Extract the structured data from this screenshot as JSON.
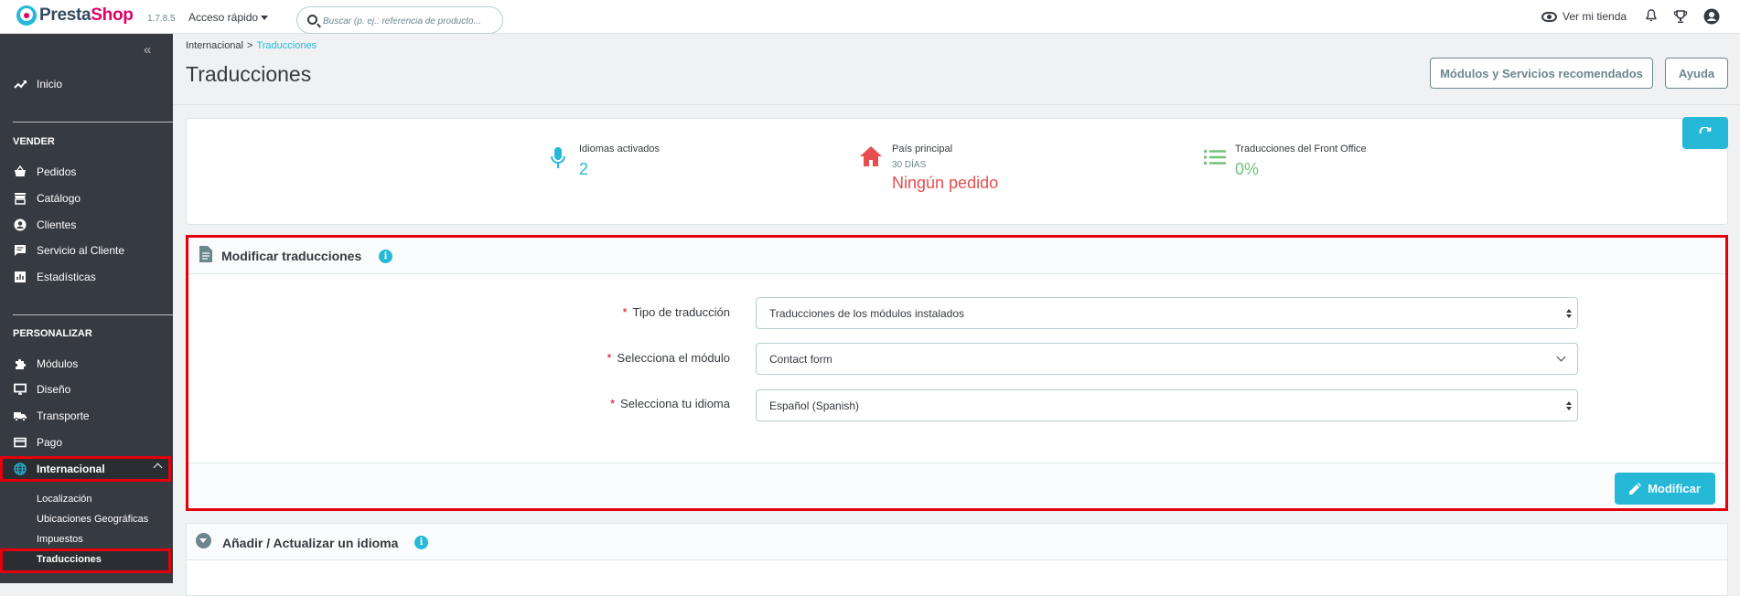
{
  "header": {
    "brand_presta": "Presta",
    "brand_shop": "Shop",
    "version": "1.7.8.5",
    "quick_access": "Acceso rápido",
    "search_placeholder": "Buscar (p. ej.: referencia de producto...",
    "view_store": "Ver mi tienda"
  },
  "sidebar": {
    "home": "Inicio",
    "sell_section": "VENDER",
    "sell_items": [
      "Pedidos",
      "Catálogo",
      "Clientes",
      "Servicio al Cliente",
      "Estadísticas"
    ],
    "customize_section": "PERSONALIZAR",
    "customize_items": [
      "Módulos",
      "Diseño",
      "Transporte",
      "Pago"
    ],
    "active_item": "Internacional",
    "sub_items": [
      "Localización",
      "Ubicaciones Geográficas",
      "Impuestos",
      "Traducciones"
    ]
  },
  "breadcrumb": {
    "parent": "Internacional",
    "separator": ">",
    "current": "Traducciones"
  },
  "page": {
    "title": "Traducciones",
    "recommended_button": "Módulos y Servicios recomendados",
    "help_button": "Ayuda"
  },
  "kpis": [
    {
      "label": "Idiomas activados",
      "sublabel": "",
      "value": "2",
      "color": "#25b9d7"
    },
    {
      "label": "País principal",
      "sublabel": "30 DÍAS",
      "value": "Ningún pedido",
      "color": "#e84e4e"
    },
    {
      "label": "Traducciones del Front Office",
      "sublabel": "",
      "value": "0%",
      "color": "#72c279"
    }
  ],
  "modify_panel": {
    "title": "Modificar traducciones",
    "required_mark": "*",
    "fields": [
      {
        "label": "Tipo de traducción",
        "value": "Traducciones de los módulos instalados"
      },
      {
        "label": "Selecciona el módulo",
        "value": "Contact form"
      },
      {
        "label": "Selecciona tu idioma",
        "value": "Español (Spanish)"
      }
    ],
    "submit": "Modificar"
  },
  "add_panel": {
    "title": "Añadir / Actualizar un idioma"
  },
  "colors": {
    "accent": "#25b9d7",
    "sidebar": "#363a41",
    "highlight": "#e3000b"
  }
}
